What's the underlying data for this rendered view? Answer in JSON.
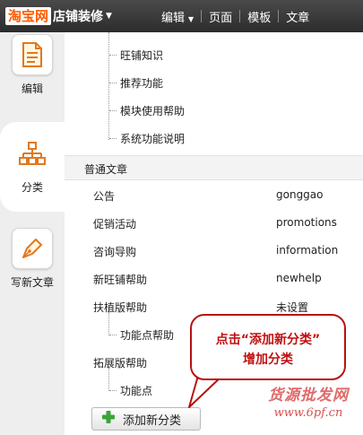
{
  "header": {
    "brand": "淘宝网",
    "title": "店铺装修",
    "nav": [
      {
        "label": "编辑"
      },
      {
        "label": "页面"
      },
      {
        "label": "模板"
      },
      {
        "label": "文章"
      }
    ]
  },
  "sidebar": {
    "items": [
      {
        "label": "编辑",
        "icon": "document-icon"
      },
      {
        "label": "分类",
        "icon": "sitemap-icon",
        "active": true
      },
      {
        "label": "写新文章",
        "icon": "pen-icon"
      }
    ]
  },
  "tree_top": [
    {
      "label": "旺铺知识"
    },
    {
      "label": "推荐功能"
    },
    {
      "label": "模块使用帮助"
    },
    {
      "label": "系统功能说明"
    }
  ],
  "section": {
    "title": "普通文章"
  },
  "categories": [
    {
      "name": "公告",
      "slug": "gonggao"
    },
    {
      "name": "促销活动",
      "slug": "promotions"
    },
    {
      "name": "咨询导购",
      "slug": "information"
    },
    {
      "name": "新旺铺帮助",
      "slug": "newhelp"
    },
    {
      "name": "扶植版帮助",
      "slug": "未设置"
    },
    {
      "name": "功能点帮助",
      "slug": ""
    },
    {
      "name": "拓展版帮助",
      "slug": ""
    },
    {
      "name": "功能点",
      "slug": ""
    }
  ],
  "add_button": {
    "label": "添加新分类"
  },
  "callout": {
    "line1": "点击“添加新分类”",
    "line2": "增加分类"
  },
  "watermark": {
    "text1": "货源批发网",
    "text2": "www.6pf.cn"
  },
  "colors": {
    "brand": "#ff5a00",
    "accent": "#c01010",
    "add_icon": "#3aa53a"
  }
}
